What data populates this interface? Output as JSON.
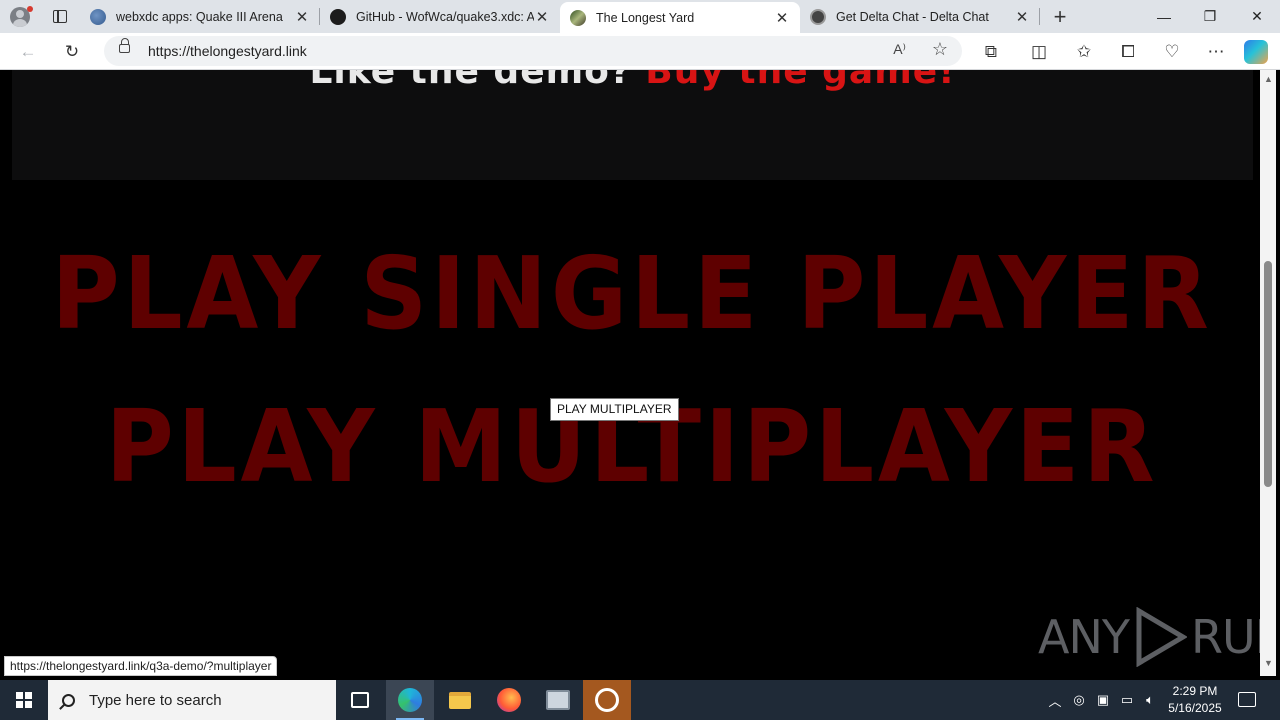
{
  "browser": {
    "tabs": [
      {
        "title": "webxdc apps: Quake III Arena",
        "active": false
      },
      {
        "title": "GitHub - WofWca/quake3.xdc: A",
        "active": false
      },
      {
        "title": "The Longest Yard",
        "active": true
      },
      {
        "title": "Get Delta Chat - Delta Chat",
        "active": false
      }
    ],
    "address": "https://thelongestyard.link",
    "status_url": "https://thelongestyard.link/q3a-demo/?multiplayer"
  },
  "page": {
    "banner_prefix": "Like the demo?",
    "banner_link": "Buy the game!",
    "single_player": "PLAY SINGLE PLAYER",
    "multiplayer": "PLAY MULTIPLAYER",
    "tooltip": "PLAY MULTIPLAYER",
    "watermark_left": "ANY",
    "watermark_right": "RUN"
  },
  "colors": {
    "banner_link": "#d81414",
    "big_link": "#5e0000",
    "page_background": "#000000"
  },
  "taskbar": {
    "search_placeholder": "Type here to search",
    "time": "2:29 PM",
    "date": "5/16/2025"
  }
}
